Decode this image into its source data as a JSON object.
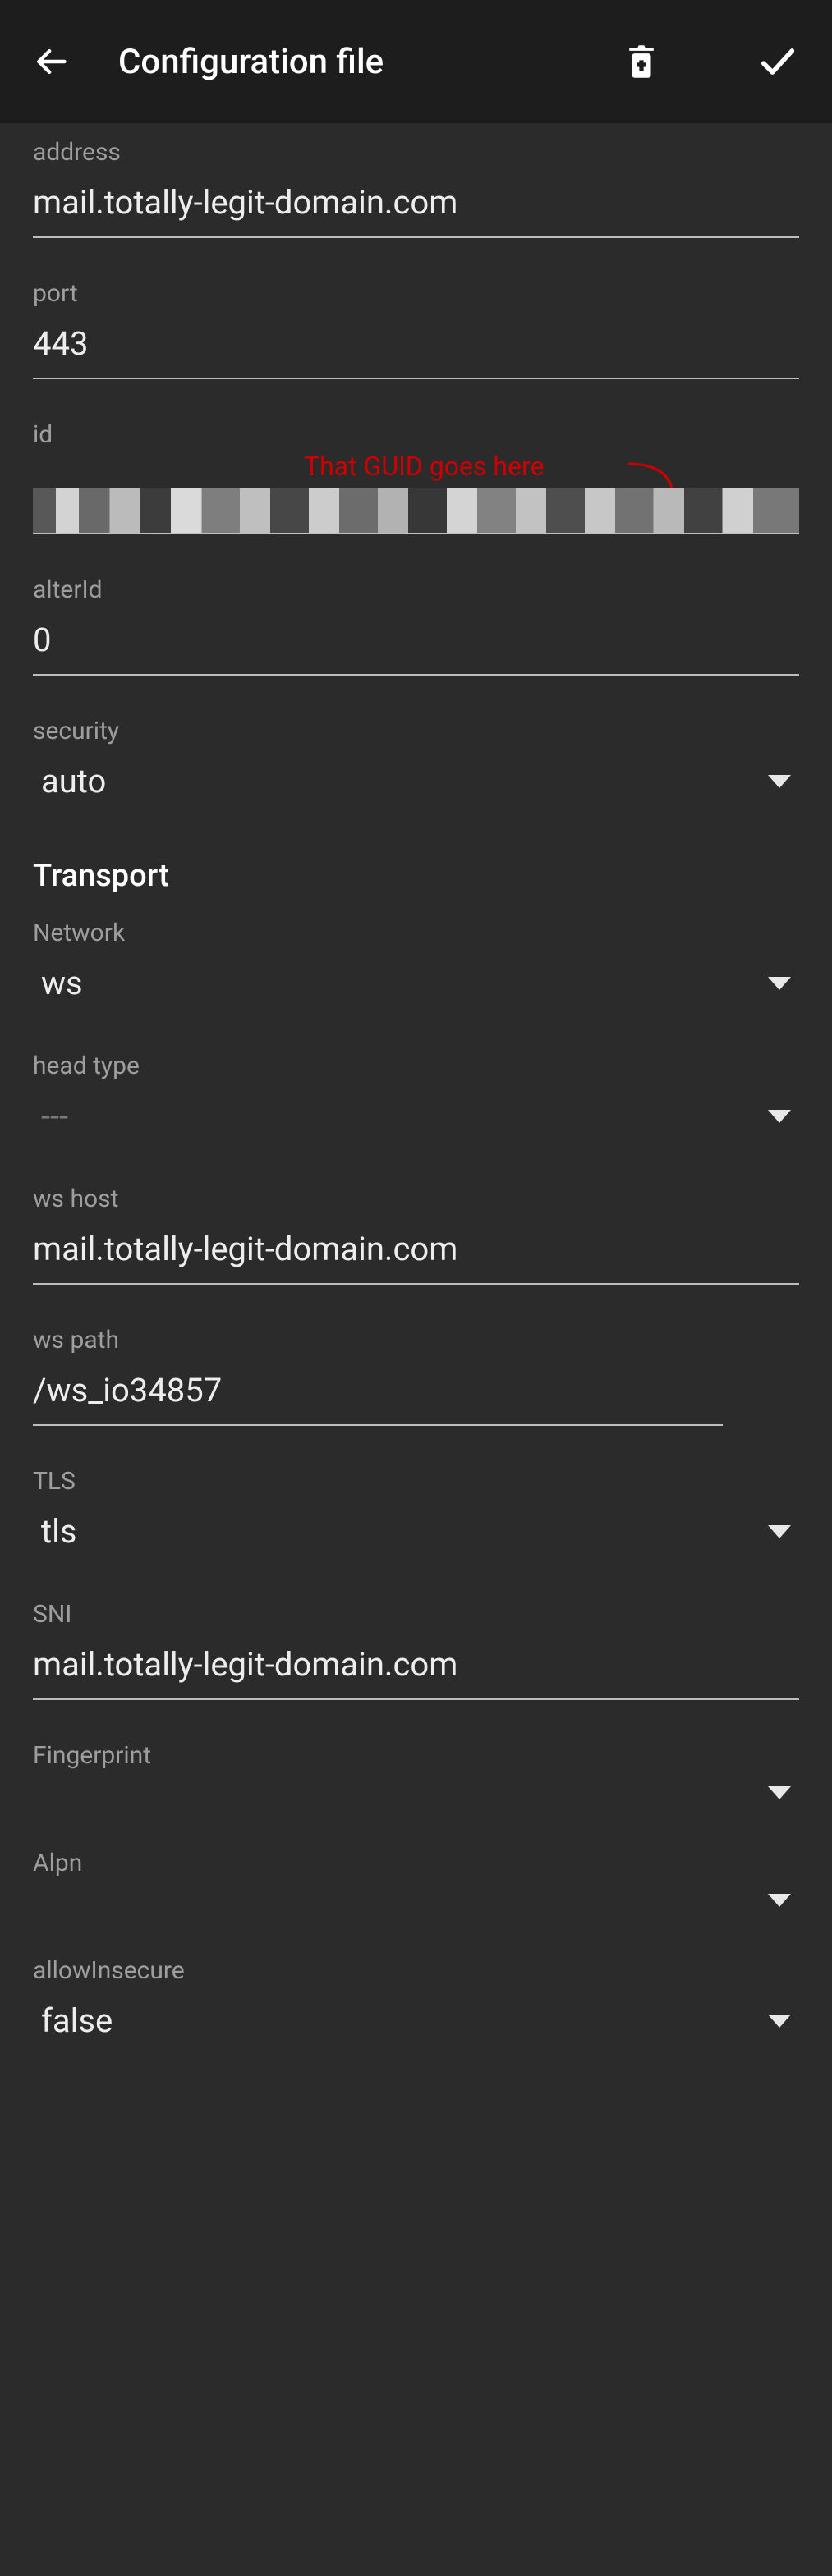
{
  "header": {
    "title": "Configuration file"
  },
  "fields": {
    "address": {
      "label": "address",
      "value": "mail.totally-legit-domain.com"
    },
    "port": {
      "label": "port",
      "value": "443"
    },
    "id": {
      "label": "id"
    },
    "alterId": {
      "label": "alterId",
      "value": "0"
    },
    "security": {
      "label": "security",
      "value": "auto"
    },
    "network": {
      "label": "Network",
      "value": "ws"
    },
    "headType": {
      "label": "head type",
      "value": "---"
    },
    "wsHost": {
      "label": "ws host",
      "value": "mail.totally-legit-domain.com"
    },
    "wsPath": {
      "label": "ws path",
      "value": "/ws_io34857"
    },
    "tls": {
      "label": "TLS",
      "value": "tls"
    },
    "sni": {
      "label": "SNI",
      "value": "mail.totally-legit-domain.com"
    },
    "fingerprint": {
      "label": "Fingerprint",
      "value": ""
    },
    "alpn": {
      "label": "Alpn",
      "value": ""
    },
    "allowInsecure": {
      "label": "allowInsecure",
      "value": "false"
    }
  },
  "sections": {
    "transport": "Transport"
  },
  "annotation": {
    "id_hint": "That GUID goes here"
  }
}
